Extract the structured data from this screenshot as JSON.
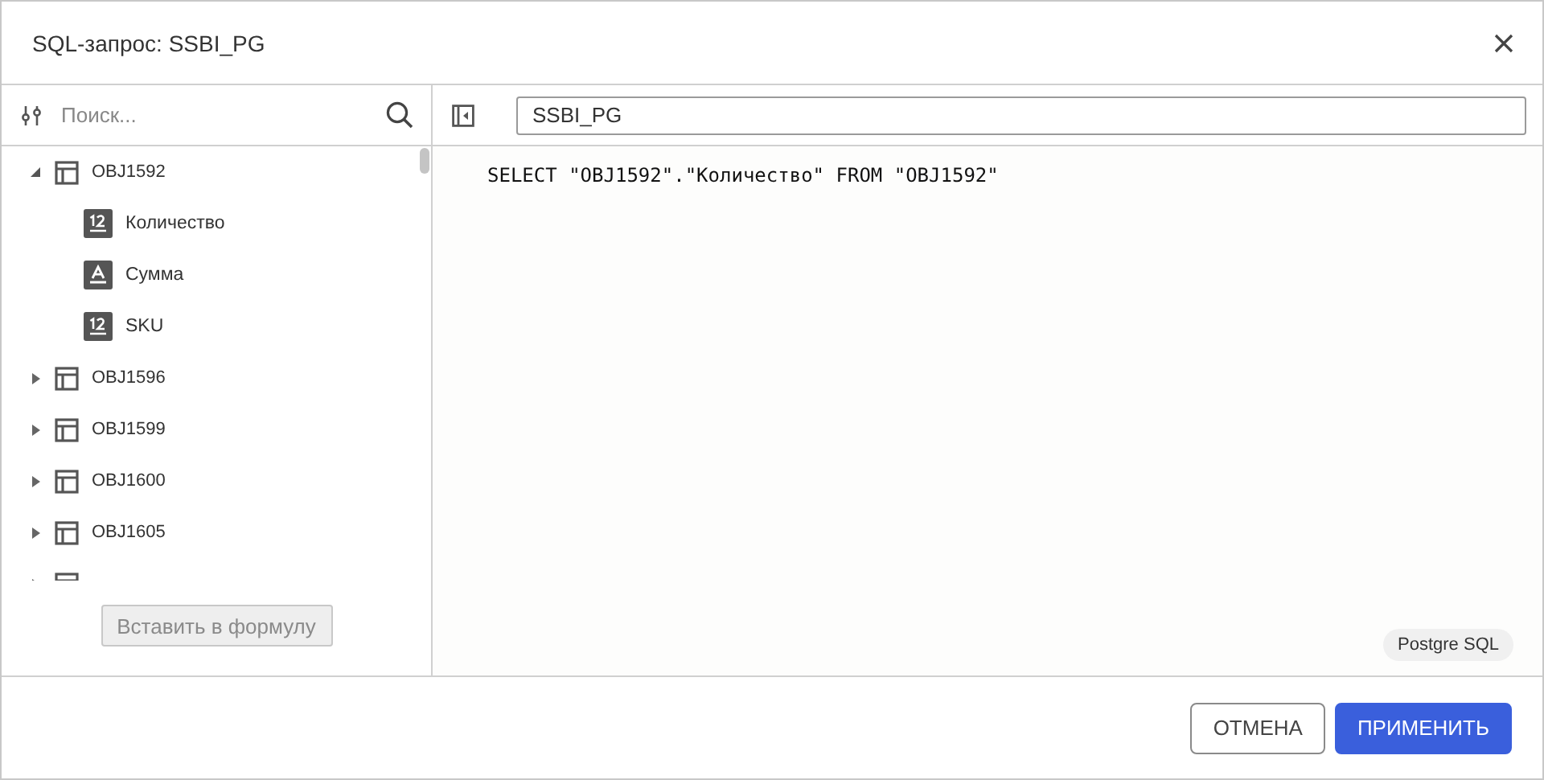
{
  "window": {
    "title": "SQL-запрос: SSBI_PG"
  },
  "search": {
    "placeholder": "Поиск..."
  },
  "tree": [
    {
      "label": "OBJ1592",
      "expanded": true,
      "children": [
        {
          "label": "Количество",
          "kind": "number"
        },
        {
          "label": "Сумма",
          "kind": "text"
        },
        {
          "label": "SKU",
          "kind": "number"
        }
      ]
    },
    {
      "label": "OBJ1596",
      "expanded": false
    },
    {
      "label": "OBJ1599",
      "expanded": false
    },
    {
      "label": "OBJ1600",
      "expanded": false
    },
    {
      "label": "OBJ1605",
      "expanded": false
    },
    {
      "expanded": false
    }
  ],
  "insert_button": {
    "label": "Вставить в формулу",
    "disabled": true
  },
  "connection": {
    "value": "SSBI_PG"
  },
  "query": "SELECT \"OBJ1592\".\"Количество\" FROM \"OBJ1592\"",
  "dialect_badge": "Postgre SQL",
  "buttons": [
    {
      "label": "ОТМЕНА",
      "kind": "secondary"
    },
    {
      "label": "ПРИМЕНИТЬ",
      "kind": "primary"
    }
  ]
}
